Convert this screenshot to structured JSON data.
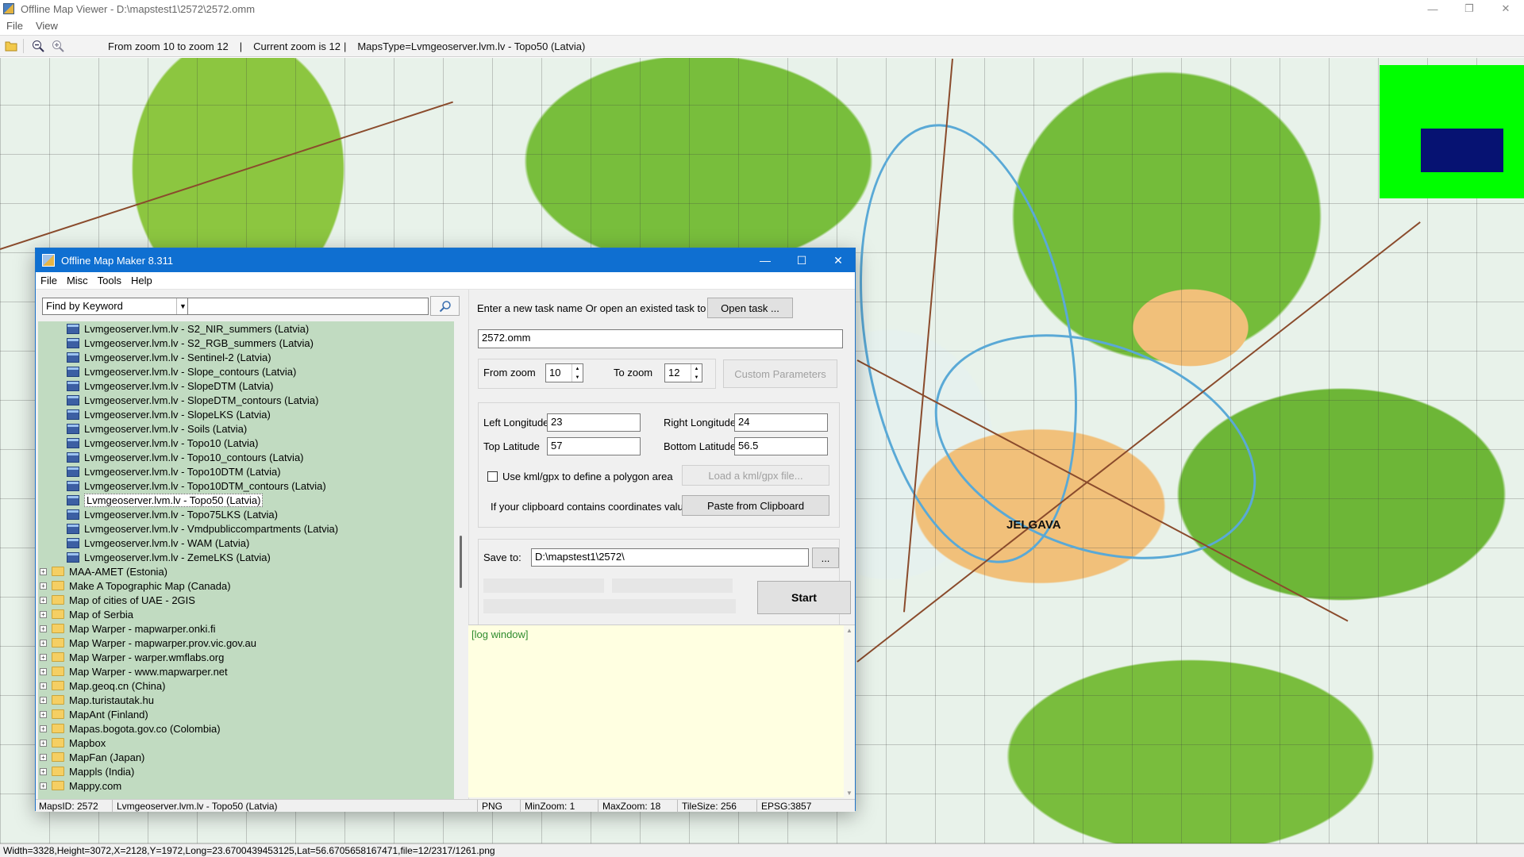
{
  "viewer": {
    "title": "Offline Map Viewer - D:\\mapstest1\\2572\\2572.omm",
    "menu": [
      "File",
      "View"
    ],
    "toolbar": {
      "zoom_range": "From zoom 10 to zoom 12",
      "current_zoom": "Current zoom is 12",
      "maps_type": "MapsType=Lvmgeoserver.lvm.lv - Topo50 (Latvia)"
    },
    "map_label": "JELGAVA",
    "status": "Width=3328,Height=3072,X=2128,Y=1972,Long=23.6700439453125,Lat=56.6705658167471,file=12/2317/1261.png",
    "colors": {
      "minimap_bg": "#00ff00",
      "minimap_viewport": "#061272"
    }
  },
  "maker": {
    "title": "Offline Map Maker 8.311",
    "menu": [
      "File",
      "Misc",
      "Tools",
      "Help"
    ],
    "find_select": "Find by Keyword",
    "search_value": "",
    "tree": [
      {
        "type": "map",
        "label": "Lvmgeoserver.lvm.lv - S2_NIR_summers (Latvia)"
      },
      {
        "type": "map",
        "label": "Lvmgeoserver.lvm.lv - S2_RGB_summers (Latvia)"
      },
      {
        "type": "map",
        "label": "Lvmgeoserver.lvm.lv - Sentinel-2 (Latvia)"
      },
      {
        "type": "map",
        "label": "Lvmgeoserver.lvm.lv - Slope_contours (Latvia)"
      },
      {
        "type": "map",
        "label": "Lvmgeoserver.lvm.lv - SlopeDTM (Latvia)"
      },
      {
        "type": "map",
        "label": "Lvmgeoserver.lvm.lv - SlopeDTM_contours (Latvia)"
      },
      {
        "type": "map",
        "label": "Lvmgeoserver.lvm.lv - SlopeLKS (Latvia)"
      },
      {
        "type": "map",
        "label": "Lvmgeoserver.lvm.lv - Soils (Latvia)"
      },
      {
        "type": "map",
        "label": "Lvmgeoserver.lvm.lv - Topo10 (Latvia)"
      },
      {
        "type": "map",
        "label": "Lvmgeoserver.lvm.lv - Topo10_contours (Latvia)"
      },
      {
        "type": "map",
        "label": "Lvmgeoserver.lvm.lv - Topo10DTM (Latvia)"
      },
      {
        "type": "map",
        "label": "Lvmgeoserver.lvm.lv - Topo10DTM_contours (Latvia)"
      },
      {
        "type": "map",
        "label": "Lvmgeoserver.lvm.lv - Topo50 (Latvia)",
        "selected": true
      },
      {
        "type": "map",
        "label": "Lvmgeoserver.lvm.lv - Topo75LKS (Latvia)"
      },
      {
        "type": "map",
        "label": "Lvmgeoserver.lvm.lv - Vmdpubliccompartments (Latvia)"
      },
      {
        "type": "map",
        "label": "Lvmgeoserver.lvm.lv - WAM (Latvia)"
      },
      {
        "type": "map",
        "label": "Lvmgeoserver.lvm.lv - ZemeLKS (Latvia)"
      },
      {
        "type": "folder",
        "label": "MAA-AMET (Estonia)"
      },
      {
        "type": "folder",
        "label": "Make A Topographic Map (Canada)"
      },
      {
        "type": "folder",
        "label": "Map of cities of UAE - 2GIS"
      },
      {
        "type": "folder",
        "label": "Map of Serbia"
      },
      {
        "type": "folder",
        "label": "Map Warper - mapwarper.onki.fi"
      },
      {
        "type": "folder",
        "label": "Map Warper - mapwarper.prov.vic.gov.au"
      },
      {
        "type": "folder",
        "label": "Map Warper - warper.wmflabs.org"
      },
      {
        "type": "folder",
        "label": "Map Warper - www.mapwarper.net"
      },
      {
        "type": "folder",
        "label": "Map.geoq.cn (China)"
      },
      {
        "type": "folder",
        "label": "Map.turistautak.hu"
      },
      {
        "type": "folder",
        "label": "MapAnt (Finland)"
      },
      {
        "type": "folder",
        "label": "Mapas.bogota.gov.co (Colombia)"
      },
      {
        "type": "folder",
        "label": "Mapbox"
      },
      {
        "type": "folder",
        "label": "MapFan (Japan)"
      },
      {
        "type": "folder",
        "label": "Mappls (India)"
      },
      {
        "type": "folder",
        "label": "Mappy.com"
      }
    ],
    "task": {
      "prompt": "Enter a new task name Or open an existed task to continue:",
      "open_button": "Open task ...",
      "name": "2572.omm"
    },
    "zoom": {
      "from_label": "From zoom",
      "from_value": "10",
      "to_label": "To zoom",
      "to_value": "12",
      "custom_button": "Custom Parameters"
    },
    "coords": {
      "left_label": "Left Longitude",
      "left_value": "23",
      "right_label": "Right Longitude",
      "right_value": "24",
      "top_label": "Top Latitude",
      "top_value": "57",
      "bottom_label": "Bottom Latitude",
      "bottom_value": "56.5"
    },
    "kml": {
      "checkbox_label": "Use kml/gpx to define a polygon area",
      "load_button": "Load a kml/gpx file..."
    },
    "clipboard": {
      "label": "If your clipboard contains coordinates values:",
      "button": "Paste from Clipboard"
    },
    "save": {
      "label": "Save to:",
      "path": "D:\\mapstest1\\2572\\",
      "browse": "..."
    },
    "start_button": "Start",
    "log_text": "[log window]",
    "status": {
      "maps_id": "MapsID: 2572",
      "maps_name": "Lvmgeoserver.lvm.lv - Topo50 (Latvia)",
      "format": "PNG",
      "min_zoom": "MinZoom: 1",
      "max_zoom": "MaxZoom: 18",
      "tile_size": "TileSize: 256",
      "epsg": "EPSG:3857"
    }
  }
}
